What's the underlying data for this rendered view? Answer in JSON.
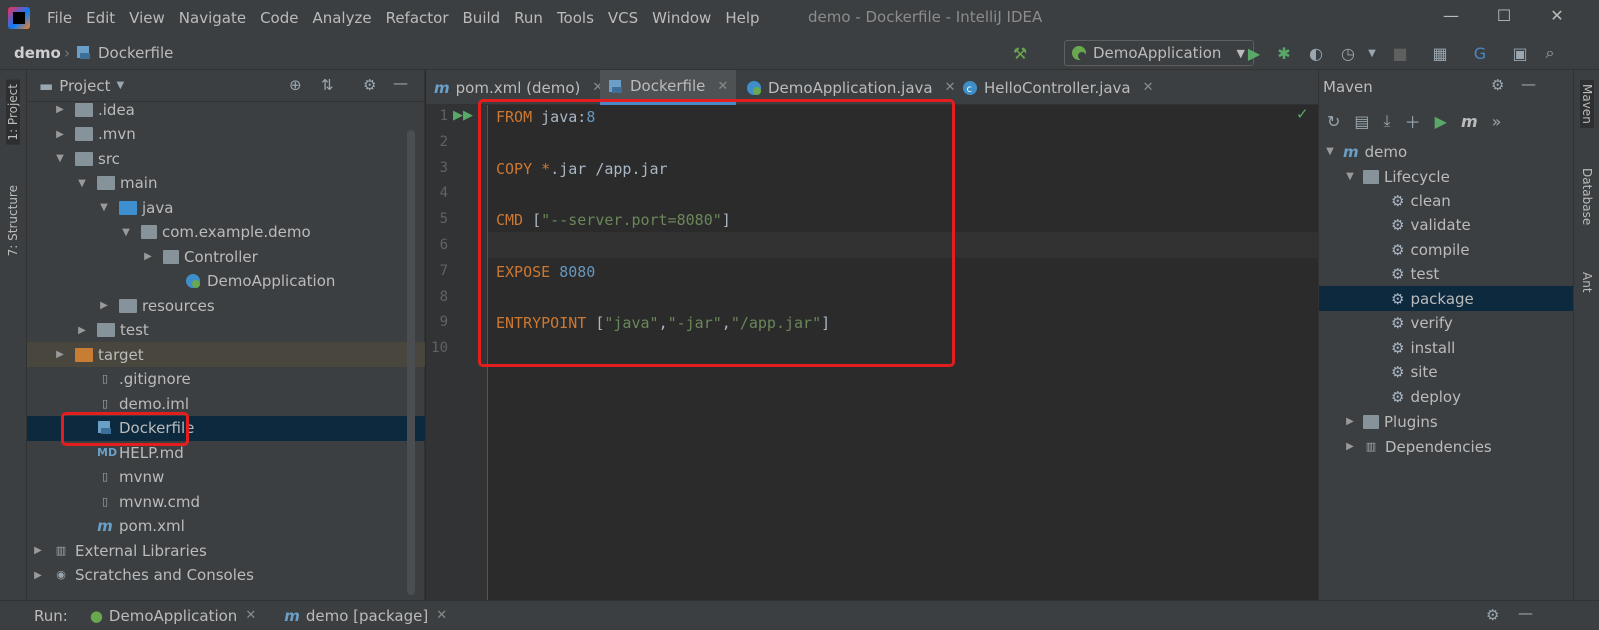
{
  "menu": [
    "File",
    "Edit",
    "View",
    "Navigate",
    "Code",
    "Analyze",
    "Refactor",
    "Build",
    "Run",
    "Tools",
    "VCS",
    "Window",
    "Help"
  ],
  "window_title": "demo - Dockerfile - IntelliJ IDEA",
  "window_controls": {
    "minimize": "—",
    "maximize": "☐",
    "close": "✕"
  },
  "breadcrumb": {
    "project": "demo",
    "file": "Dockerfile"
  },
  "run_config": "DemoApplication",
  "left_tabs": {
    "project": "1: Project",
    "structure": "7: Structure"
  },
  "right_tabs": {
    "maven": "Maven",
    "database": "Database",
    "ant": "Ant"
  },
  "project_panel": {
    "title": "Project",
    "tree": [
      {
        "label": ".idea",
        "kind": "folder",
        "depth": 1,
        "arrow": "▶"
      },
      {
        "label": ".mvn",
        "kind": "folder",
        "depth": 1,
        "arrow": "▶"
      },
      {
        "label": "src",
        "kind": "folder",
        "depth": 1,
        "arrow": "▼"
      },
      {
        "label": "main",
        "kind": "folder",
        "depth": 2,
        "arrow": "▼"
      },
      {
        "label": "java",
        "kind": "folder-blue",
        "depth": 3,
        "arrow": "▼"
      },
      {
        "label": "com.example.demo",
        "kind": "package",
        "depth": 4,
        "arrow": "▼"
      },
      {
        "label": "Controller",
        "kind": "package",
        "depth": 5,
        "arrow": "▶"
      },
      {
        "label": "DemoApplication",
        "kind": "spring-class",
        "depth": 6,
        "arrow": ""
      },
      {
        "label": "resources",
        "kind": "resources",
        "depth": 3,
        "arrow": "▶"
      },
      {
        "label": "test",
        "kind": "folder",
        "depth": 2,
        "arrow": "▶"
      },
      {
        "label": "target",
        "kind": "folder-orange",
        "depth": 1,
        "arrow": "▶"
      },
      {
        "label": ".gitignore",
        "kind": "file",
        "depth": 2,
        "arrow": ""
      },
      {
        "label": "demo.iml",
        "kind": "file",
        "depth": 2,
        "arrow": ""
      },
      {
        "label": "Dockerfile",
        "kind": "docker",
        "depth": 2,
        "arrow": ""
      },
      {
        "label": "HELP.md",
        "kind": "md",
        "depth": 2,
        "arrow": ""
      },
      {
        "label": "mvnw",
        "kind": "file",
        "depth": 2,
        "arrow": ""
      },
      {
        "label": "mvnw.cmd",
        "kind": "file",
        "depth": 2,
        "arrow": ""
      },
      {
        "label": "pom.xml",
        "kind": "maven",
        "depth": 2,
        "arrow": ""
      },
      {
        "label": "External Libraries",
        "kind": "libs",
        "depth": 0,
        "arrow": "▶"
      },
      {
        "label": "Scratches and Consoles",
        "kind": "scratch",
        "depth": 0,
        "arrow": "▶"
      }
    ]
  },
  "editor_tabs": [
    {
      "label": "pom.xml (demo)",
      "icon": "maven-icon"
    },
    {
      "label": "Dockerfile",
      "icon": "docker-icon"
    },
    {
      "label": "DemoApplication.java",
      "icon": "spring-class-icon"
    },
    {
      "label": "HelloController.java",
      "icon": "class-icon"
    }
  ],
  "code_lines": [
    {
      "n": "1",
      "tokens": [
        {
          "t": "FROM",
          "c": "kw"
        },
        {
          "t": " java:",
          "c": ""
        },
        {
          "t": "8",
          "c": "num"
        }
      ]
    },
    {
      "n": "2",
      "tokens": []
    },
    {
      "n": "3",
      "tokens": [
        {
          "t": "COPY",
          "c": "kw"
        },
        {
          "t": " ",
          "c": ""
        },
        {
          "t": "*",
          "c": "kw"
        },
        {
          "t": ".jar /app.jar",
          "c": ""
        }
      ]
    },
    {
      "n": "4",
      "tokens": []
    },
    {
      "n": "5",
      "tokens": [
        {
          "t": "CMD",
          "c": "kw"
        },
        {
          "t": " [",
          "c": ""
        },
        {
          "t": "\"--server.port=8080\"",
          "c": "str"
        },
        {
          "t": "]",
          "c": ""
        }
      ]
    },
    {
      "n": "6",
      "tokens": []
    },
    {
      "n": "7",
      "tokens": [
        {
          "t": "EXPOSE",
          "c": "kw"
        },
        {
          "t": " ",
          "c": ""
        },
        {
          "t": "8080",
          "c": "num"
        }
      ]
    },
    {
      "n": "8",
      "tokens": []
    },
    {
      "n": "9",
      "tokens": [
        {
          "t": "ENTRYPOINT",
          "c": "kw"
        },
        {
          "t": " [",
          "c": ""
        },
        {
          "t": "\"java\"",
          "c": "str"
        },
        {
          "t": ",",
          "c": ""
        },
        {
          "t": "\"-jar\"",
          "c": "str"
        },
        {
          "t": ",",
          "c": ""
        },
        {
          "t": "\"/app.jar\"",
          "c": "str"
        },
        {
          "t": "]",
          "c": ""
        }
      ]
    },
    {
      "n": "10",
      "tokens": []
    }
  ],
  "maven_panel": {
    "title": "Maven",
    "project": "demo",
    "lifecycle": "Lifecycle",
    "phases": [
      "clean",
      "validate",
      "compile",
      "test",
      "package",
      "verify",
      "install",
      "site",
      "deploy"
    ],
    "selected_phase": "package",
    "plugins": "Plugins",
    "dependencies": "Dependencies"
  },
  "bottom_bar": {
    "run_label": "Run:",
    "tabs": [
      "DemoApplication",
      "demo [package]"
    ]
  },
  "colors": {
    "highlight": "#e41e1e",
    "selection": "#0d293e",
    "keyword": "#cc7832",
    "number": "#6897bb",
    "string": "#6a8759"
  }
}
